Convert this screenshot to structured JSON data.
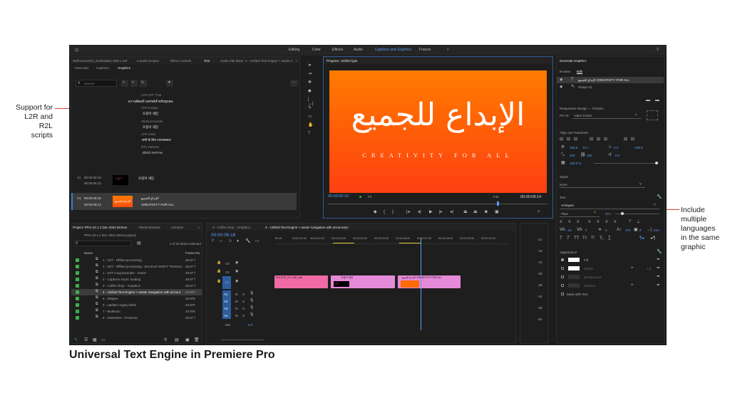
{
  "annotations": {
    "left": [
      "Support for",
      "L2R and R2L",
      "scripts"
    ],
    "right": [
      "Include",
      "multiple",
      "languages",
      "in the same",
      "graphic"
    ],
    "caption": "Universal Text Engine in Premiere Pro"
  },
  "workspaces": [
    "Editing",
    "Color",
    "Effects",
    "Audio",
    "Captions and Graphics",
    "Francis"
  ],
  "left_panel": {
    "tabs": [
      "SelfCare10min_Embedded_008-1.mxf",
      "Lumetri Scopes",
      "Effect Controls",
      "Text",
      "Audio Clip Mixer: 4 - Unified Text Engine > easier n"
    ],
    "subtabs": [
      "Transcript",
      "Captions",
      "Graphics"
    ],
    "search_placeholder": "Search",
    "lines": [
      {
        "label": "LTR UTF Thai",
        "text": "ความคิดสร้างสรรค์สำหรับทุกคน"
      },
      {
        "label": "LTR Korean",
        "text": "오징어 게임"
      },
      {
        "label": "Vertical Korean",
        "text": "오징어 게임"
      },
      {
        "label": "LTR Hindi",
        "text": "सभी के लिए रचनात्मकता"
      },
      {
        "label": "RTL Hebrew",
        "text": "יצירתיות לכולם"
      }
    ],
    "caption1": {
      "track": "V1",
      "in": "00:00:02:16",
      "out": "00:00:05:13",
      "text": "오징어 게임"
    },
    "caption2": {
      "track": "V1",
      "in": "00:00:05:18",
      "out": "00:00:08:14",
      "line1": "الإبداع للجميع",
      "line2": "CREATIVITY FOR ALL"
    }
  },
  "program": {
    "title": "Program: Unified type",
    "arabic": "الإبداع للجميع",
    "english": "CREATIVITY FOR ALL",
    "timecode": "00:00:06:16",
    "fit": "Fit",
    "full": "Full",
    "duration": "00:00:08:14"
  },
  "project": {
    "tabs": [
      "Project: PPro 22.1.1 Dec 2021 Demos",
      "Media Browser",
      "Libraries"
    ],
    "file": "PPro 22.1.1 Dec 2021 Demos.prproj",
    "count": "1 of 24 items selected",
    "col_name": "Name",
    "col_rate": "Frame Ra",
    "items": [
      {
        "name": "1 - S2T - Offline processing",
        "rate": "29.97 f"
      },
      {
        "name": "1 - S2T - Offline processing - BACKUP DON'T TRANSCR",
        "rate": "29.97 f"
      },
      {
        "name": "1 - S2T Long Example - 10min",
        "rate": "29.97 f"
      },
      {
        "name": "2 - Captions Async loading",
        "rate": "29.97 f"
      },
      {
        "name": "3 - Coffee shop - Graphics",
        "rate": "29.97 f"
      },
      {
        "name": "4 - Unified Text Engine > easier navigation with arrow k",
        "rate": "24.00 f"
      },
      {
        "name": "5 - Shapes",
        "rate": "23.976"
      },
      {
        "name": "6 - Update Legacy titles",
        "rate": "23.976"
      },
      {
        "name": "7 - Multicam",
        "rate": "23.976"
      },
      {
        "name": "8 - Gametree - Proarrow",
        "rate": "29.97 f"
      }
    ]
  },
  "timeline": {
    "tabs": [
      "3 - Coffee shop - Graphics",
      "4 - Unified Text Engine > easier navigation with arrow keys"
    ],
    "timecode": "00:00:06:16",
    "ruler": [
      ":00:00",
      "00:00:01:00",
      "00:00:02:00",
      "00:00:03:00",
      "00:00:04:00",
      "00:00:05:00",
      "00:00:06:00",
      "00:00:07:00",
      "00:00:08:00",
      "00:00:09:00",
      "00:00:10:00"
    ],
    "video_tracks": [
      "V3",
      "V2",
      "V1"
    ],
    "audio_tracks": [
      "A1",
      "A2",
      "A3",
      "A4"
    ],
    "mix": "Mix",
    "mix_val": "0.0",
    "clips": [
      {
        "label": "PHI UTE_22.1_AR_sub",
        "color": "#f06aa6"
      },
      {
        "label": "오징어 게임",
        "color": "#e58ad8"
      },
      {
        "label": "الإبداع للجميع CREATIVITY FOR ALL",
        "color": "#e58ad8"
      }
    ]
  },
  "meters": [
    "-12",
    "-18",
    "-24",
    "-30",
    "-36",
    "-42",
    "-48",
    "-54"
  ],
  "essential": {
    "title": "Essential Graphics",
    "tabs": [
      "Browse",
      "Edit"
    ],
    "layers": [
      "الإبداع للجميع CREATIVITY FOR ALL",
      "Shape 01"
    ],
    "responsive": "Responsive Design — Position",
    "pin_to_label": "Pin To:",
    "pin_to": "Video Frame",
    "align": "Align and Transform",
    "pos_x": "160.5",
    "pos_y": "73.7",
    "rot": "0.0",
    "anchor": "-108.9",
    "scale_pct": "100",
    "scale_pct2": "100",
    "opacity": "100.0 %",
    "styles_label": "Styles",
    "style_value": "None",
    "text_label": "Text",
    "font": "Al Bayan",
    "weight": "Plain",
    "size": "371",
    "tracking": "-16",
    "kerning": "0",
    "leading": "0",
    "baseline": "170",
    "tsume": "0",
    "tab_width": "410",
    "appearance": "Appearance",
    "fill": "Fill",
    "stroke": "Stroke",
    "stroke_val": "1.0",
    "background": "Background",
    "shadow": "Shadow",
    "mask": "Mask with Text"
  },
  "colors": {
    "accent": "#5a9ef5",
    "program_top": "#ff6a00",
    "program_bottom": "#ff4a10",
    "annotation_red": "#e23b3b"
  }
}
